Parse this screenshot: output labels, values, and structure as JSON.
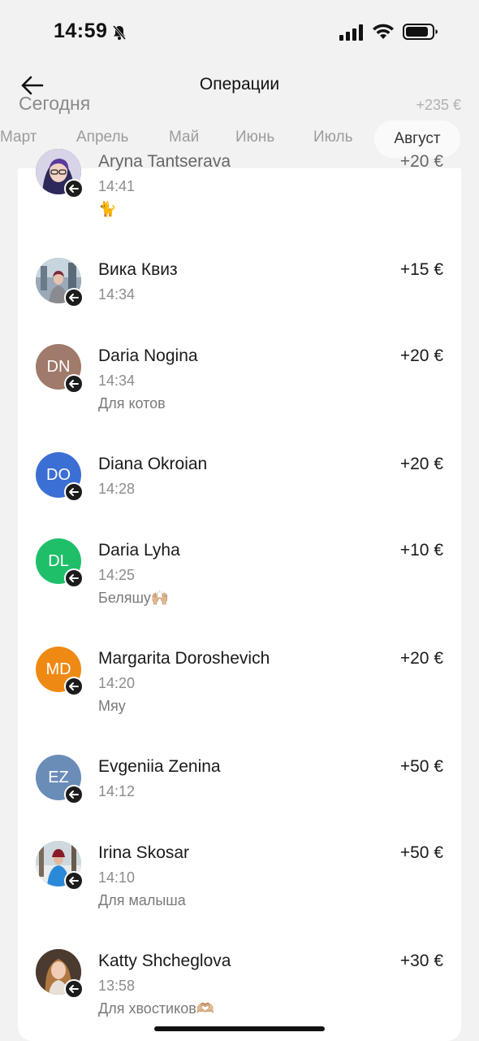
{
  "status": {
    "time": "14:59"
  },
  "header": {
    "title": "Операции",
    "day_label": "Сегодня",
    "day_total": "+235 €"
  },
  "months": [
    "Март",
    "Апрель",
    "Май",
    "Июнь",
    "Июль",
    "Август"
  ],
  "selected_month": "Август",
  "operations": [
    {
      "name": "Aryna Tantserava",
      "time": "14:41",
      "note": "🐈",
      "amount": "+20 €",
      "avatar": {
        "type": "photo",
        "color": "#3a3550"
      }
    },
    {
      "name": "Вика Квиз",
      "time": "14:34",
      "note": "",
      "amount": "+15 €",
      "avatar": {
        "type": "photo",
        "color": "#7a8a9a"
      }
    },
    {
      "name": "Daria Nogina",
      "time": "14:34",
      "note": "Для котов",
      "amount": "+20 €",
      "avatar": {
        "type": "initials",
        "initials": "DN",
        "color": "#a07a6a"
      }
    },
    {
      "name": "Diana Okroian",
      "time": "14:28",
      "note": "",
      "amount": "+20 €",
      "avatar": {
        "type": "initials",
        "initials": "DO",
        "color": "#3b6fd4"
      }
    },
    {
      "name": "Daria Lyha",
      "time": "14:25",
      "note": "Беляшу🙌🏼",
      "amount": "+10 €",
      "avatar": {
        "type": "initials",
        "initials": "DL",
        "color": "#1fbf6a"
      }
    },
    {
      "name": "Margarita Doroshevich",
      "time": "14:20",
      "note": "Мяу",
      "amount": "+20 €",
      "avatar": {
        "type": "initials",
        "initials": "MD",
        "color": "#ee8a14"
      }
    },
    {
      "name": "Evgeniia Zenina",
      "time": "14:12",
      "note": "",
      "amount": "+50 €",
      "avatar": {
        "type": "initials",
        "initials": "EZ",
        "color": "#6a8db8"
      }
    },
    {
      "name": "Irina Skosar",
      "time": "14:10",
      "note": "Для малыша",
      "amount": "+50 €",
      "avatar": {
        "type": "photo",
        "color": "#6b8fa8"
      }
    },
    {
      "name": "Katty Shcheglova",
      "time": "13:58",
      "note": "Для хвостиков🫶🏼",
      "amount": "+30 €",
      "avatar": {
        "type": "photo",
        "color": "#8a6a50"
      }
    }
  ],
  "icons": {
    "back": "arrow-left-icon",
    "bell": "bell-slash-icon",
    "signal": "cellular-signal-icon",
    "wifi": "wifi-icon",
    "battery": "battery-icon",
    "incoming": "arrow-left-badge-icon"
  }
}
